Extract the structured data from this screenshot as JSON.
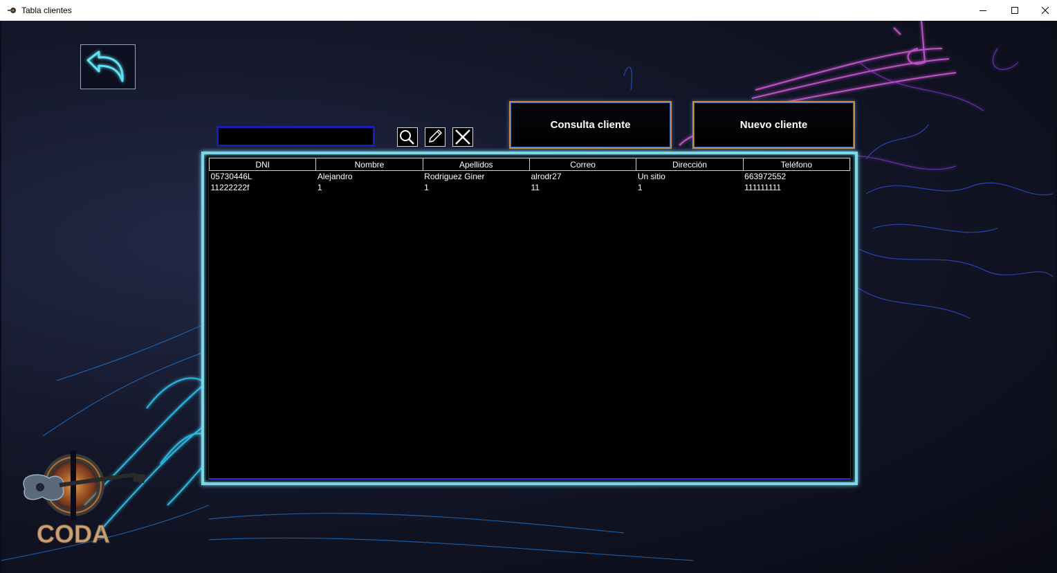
{
  "window": {
    "title": "Tabla clientes"
  },
  "toolbar": {
    "search_value": "",
    "consulta_label": "Consulta cliente",
    "nuevo_label": "Nuevo cliente"
  },
  "icons": {
    "back": "back-arrow-icon",
    "search": "search-icon",
    "edit": "pencil-icon",
    "delete": "close-icon"
  },
  "table": {
    "headers": [
      "DNI",
      "Nombre",
      "Apellidos",
      "Correo",
      "Dirección",
      "Teléfono"
    ],
    "rows": [
      [
        "05730446L",
        "Alejandro",
        "Rodriguez Giner",
        "alrodr27",
        "Un sitio",
        "663972552"
      ],
      [
        "11222222f",
        "1",
        "1",
        "11",
        "1",
        "111111111"
      ]
    ]
  },
  "logo": {
    "text": "CODA"
  },
  "colors": {
    "accent_cyan": "#7fd6e0",
    "search_border": "#1420b8",
    "button_border": "#c88a3a"
  }
}
